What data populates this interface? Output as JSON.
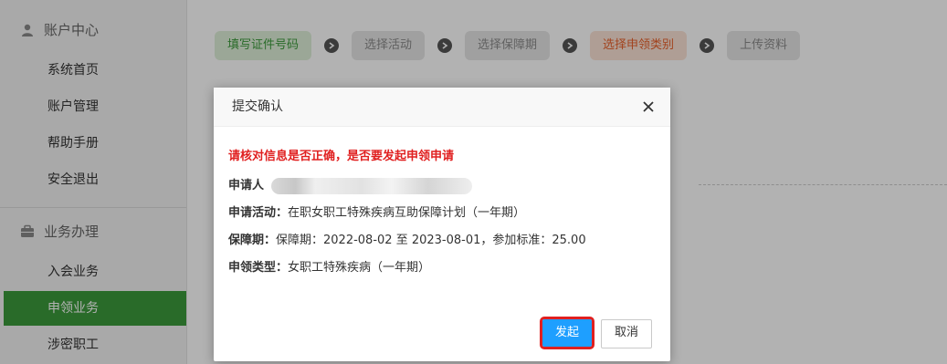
{
  "sidebar": {
    "sections": [
      {
        "title": "账户中心",
        "icon": "user-icon",
        "items": [
          "系统首页",
          "账户管理",
          "帮助手册",
          "安全退出"
        ]
      },
      {
        "title": "业务办理",
        "icon": "briefcase-icon",
        "items": [
          "入会业务",
          "申领业务",
          "涉密职工"
        ]
      }
    ],
    "active_item": "申领业务"
  },
  "steps": [
    "填写证件号码",
    "选择活动",
    "选择保障期",
    "选择申领类别",
    "上传资料"
  ],
  "dialog": {
    "title": "提交确认",
    "warning": "请核对信息是否正确，是否要发起申领申请",
    "applicant_label": "申请人",
    "activity_label": "申请活动：",
    "activity_value": "在职女职工特殊疾病互助保障计划（一年期）",
    "period_label": "保障期：",
    "period_value": "保障期：2022-08-02 至 2023-08-01，参加标准：25.00",
    "type_label": "申领类型：",
    "type_value": "女职工特殊疾病（一年期）",
    "confirm_label": "发起",
    "cancel_label": "取消"
  },
  "colors": {
    "sidebar_active": "#3c9a3c",
    "primary_button": "#1e9fff",
    "warning": "#e02020",
    "step_done": "#3c9a3c",
    "step_current": "#e8612c"
  }
}
